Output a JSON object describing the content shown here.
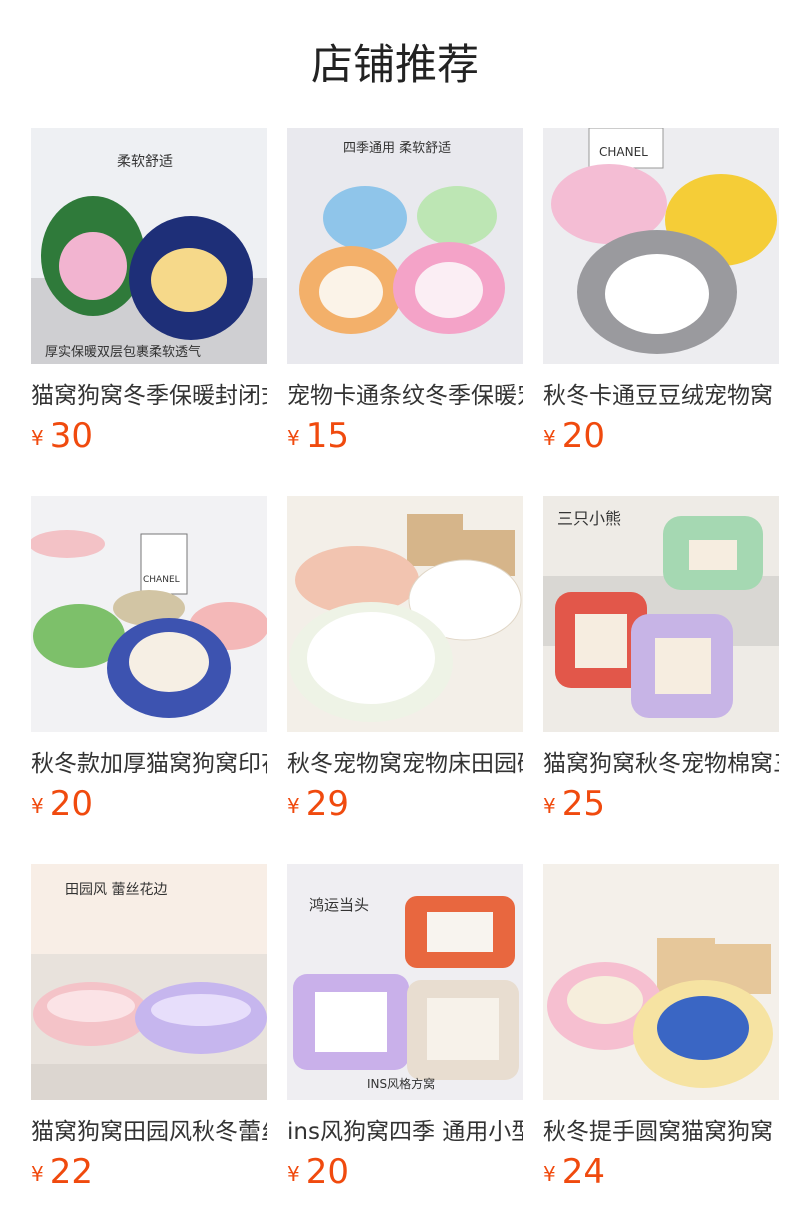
{
  "page_title": "店铺推荐",
  "currency_symbol": "¥",
  "products": [
    {
      "title": "猫窝狗窝冬季保暖封闭式宠物窝",
      "price": "30",
      "image_caption_top": "柔软舒适",
      "image_caption_bottom": "厚实保暖双层包裹柔软透气",
      "image_colors": [
        "#2f7a3a",
        "#1e2f78",
        "#f2b4d0",
        "#f6d98a"
      ]
    },
    {
      "title": "宠物卡通条纹冬季保暖宠物窝",
      "price": "15",
      "image_caption_top": "四季通用 柔软舒适",
      "image_colors": [
        "#8fc5ea",
        "#bde6b4",
        "#f3b06a",
        "#f4a3c8"
      ]
    },
    {
      "title": "秋冬卡通豆豆绒宠物窝",
      "price": "20",
      "image_caption_top": "CHANEL",
      "image_colors": [
        "#f4bdd4",
        "#f5cd37",
        "#9a9a9e",
        "#ffffff"
      ]
    },
    {
      "title": "秋冬款加厚猫窝狗窝印花宠物窝",
      "price": "20",
      "image_caption_top": "CHANEL",
      "image_colors": [
        "#7dc06a",
        "#3d53b0",
        "#f4b8b8",
        "#d2c5a4"
      ]
    },
    {
      "title": "秋冬宠物窝宠物床田园碎花",
      "price": "29",
      "image_colors": [
        "#f3efe8",
        "#ffffff",
        "#d6b58a",
        "#f2c4b0"
      ]
    },
    {
      "title": "猫窝狗窝秋冬宠物棉窝三只小熊",
      "price": "25",
      "image_caption_top": "三只小熊",
      "image_colors": [
        "#a5d8b2",
        "#e2574a",
        "#c7b4e6",
        "#f6ede0"
      ]
    },
    {
      "title": "猫窝狗窝田园风秋冬蕾丝花边",
      "price": "22",
      "image_caption_top": "田园风 蕾丝花边",
      "image_colors": [
        "#f4c3c8",
        "#c6b6ee",
        "#f8eee6",
        "#e8e2dc"
      ]
    },
    {
      "title": "ins风狗窝四季 通用小型犬",
      "price": "20",
      "image_caption_top": "鸿运当头",
      "image_caption_bottom": "INS风格方窝",
      "image_colors": [
        "#e8673f",
        "#c9b0ea",
        "#e8ddd0",
        "#ffffff"
      ]
    },
    {
      "title": "秋冬提手圆窝猫窝狗窝",
      "price": "24",
      "image_colors": [
        "#f6bfd0",
        "#f6e3a2",
        "#f4f0ea",
        "#3a66c4"
      ]
    }
  ]
}
